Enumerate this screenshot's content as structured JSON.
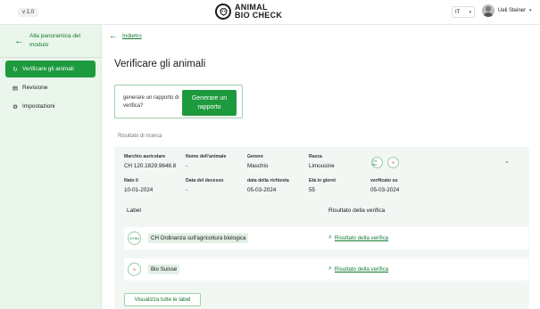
{
  "header": {
    "version": "v 1.0",
    "logo_line1": "ANIMAL",
    "logo_line2": "BIO CHECK",
    "language": "IT",
    "user_name": "Ueli Steiner"
  },
  "sidebar": {
    "back_label": "Alla panoramica del modulo",
    "items": [
      {
        "label": "Verificare gli animali",
        "icon": "refresh-icon",
        "active": true
      },
      {
        "label": "Revisione",
        "icon": "list-icon",
        "active": false
      },
      {
        "label": "Impostazioni",
        "icon": "gear-icon",
        "active": false
      }
    ]
  },
  "main": {
    "back_label": "Indietro",
    "title": "Verificare gli animali",
    "generate_prompt": "generare un rapporto di verifica?",
    "generate_button": "Generare un rapporto",
    "results_label": "Risultato di ricerca",
    "result": {
      "fields": [
        {
          "key": "Marchio auricolare",
          "value": "CH 120.1829.9648.8"
        },
        {
          "key": "Nome dell'animale",
          "value": "-"
        },
        {
          "key": "Genere",
          "value": "Maschio"
        },
        {
          "key": "Razza",
          "value": "Limousine"
        },
        {
          "key": "Nato il",
          "value": "10-01-2024"
        },
        {
          "key": "Data del decesso",
          "value": "-"
        },
        {
          "key": "data della richiesta",
          "value": "05-03-2024"
        },
        {
          "key": "Età in giorni",
          "value": "55"
        },
        {
          "key": "verificato su",
          "value": "05-03-2024"
        }
      ],
      "badge1": "CH Bio",
      "badge2": "B"
    },
    "table": {
      "col_label": "Label",
      "col_result": "Risultato della verifica",
      "rows": [
        {
          "badge": "CH Bio",
          "label": "CH Ordinanza sull'agricoltura biologica",
          "link": "Risultato della verifica"
        },
        {
          "badge": "B",
          "label": "Bio Suisse",
          "link": "Risultato della verifica"
        }
      ]
    },
    "show_all_button": "Visualizza tutte le label"
  },
  "colors": {
    "primary": "#1e9a3e",
    "link": "#137a2e",
    "sidebar_bg": "#eaf6ec",
    "panel_bg": "#f3f7f4"
  }
}
